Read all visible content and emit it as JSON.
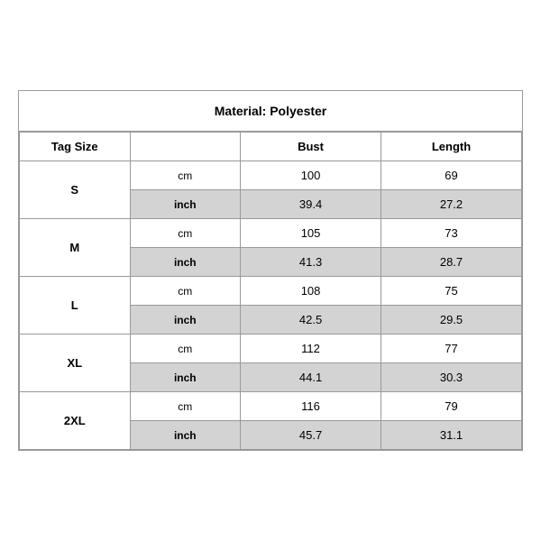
{
  "title": "Material: Polyester",
  "headers": {
    "tag_size": "Tag Size",
    "bust": "Bust",
    "length": "Length"
  },
  "sizes": [
    {
      "tag": "S",
      "cm": {
        "bust": "100",
        "length": "69"
      },
      "inch": {
        "bust": "39.4",
        "length": "27.2"
      }
    },
    {
      "tag": "M",
      "cm": {
        "bust": "105",
        "length": "73"
      },
      "inch": {
        "bust": "41.3",
        "length": "28.7"
      }
    },
    {
      "tag": "L",
      "cm": {
        "bust": "108",
        "length": "75"
      },
      "inch": {
        "bust": "42.5",
        "length": "29.5"
      }
    },
    {
      "tag": "XL",
      "cm": {
        "bust": "112",
        "length": "77"
      },
      "inch": {
        "bust": "44.1",
        "length": "30.3"
      }
    },
    {
      "tag": "2XL",
      "cm": {
        "bust": "116",
        "length": "79"
      },
      "inch": {
        "bust": "45.7",
        "length": "31.1"
      }
    }
  ],
  "unit_cm": "cm",
  "unit_inch": "inch"
}
